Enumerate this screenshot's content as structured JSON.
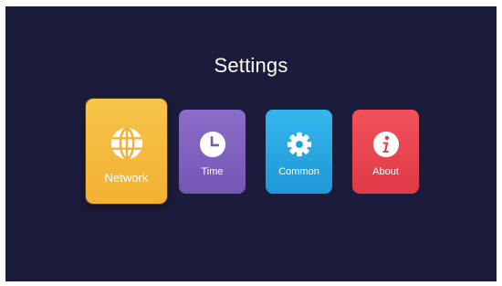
{
  "screen": {
    "title": "Settings",
    "background_color": "#1b1b3b"
  },
  "tiles": [
    {
      "label": "Network",
      "icon": "globe-icon",
      "color": "#f4b840",
      "selected": true
    },
    {
      "label": "Time",
      "icon": "clock-icon",
      "color": "#7f62bf",
      "selected": false
    },
    {
      "label": "Common",
      "icon": "gear-icon",
      "color": "#28a8e3",
      "selected": false
    },
    {
      "label": "About",
      "icon": "info-icon",
      "color": "#e8454f",
      "selected": false
    }
  ]
}
